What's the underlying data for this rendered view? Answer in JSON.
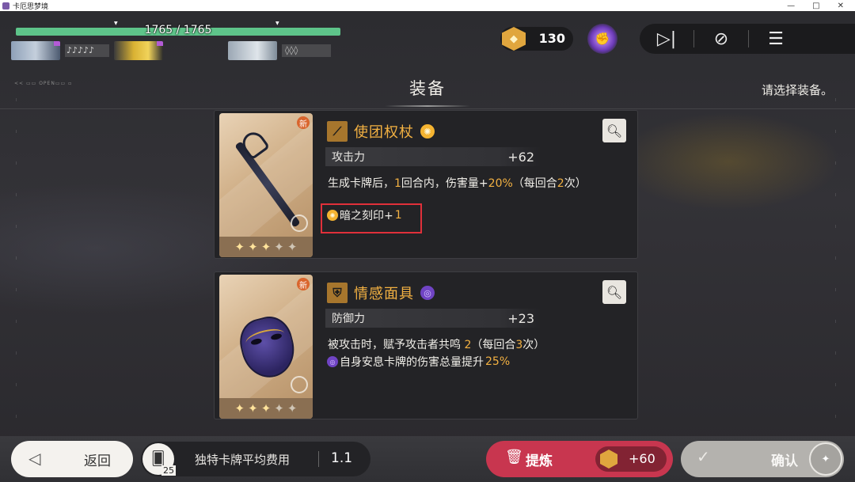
{
  "window": {
    "title": "卡厄思梦境",
    "minimize": "—",
    "maximize": "□",
    "close": "✕"
  },
  "hud": {
    "hp_text": "1765 / 1765",
    "hp_fraction": 1.0,
    "party": [
      {
        "name": "portrait-1",
        "extra": "♪♪♪♪♪"
      },
      {
        "name": "portrait-2",
        "extra": ""
      },
      {
        "name": "portrait-3",
        "extra": "◊◊◊"
      }
    ],
    "currency_value": "130",
    "currency_icon": "gem-icon",
    "controls": [
      "play-skip-icon",
      "speed-icon",
      "menu-icon"
    ]
  },
  "header": {
    "title": "装备",
    "hint": "请选择装备。",
    "mini_label": "<<  ▭▭  OPEN▭▭  ▫"
  },
  "equipment": [
    {
      "new_badge": "新",
      "type_icon": "sword-icon",
      "name": "使团权杖",
      "element_icon": "sun-icon",
      "stat_label": "攻击力",
      "stat_value": "+62",
      "desc_before": "生成卡牌后，",
      "desc_n1": "1",
      "desc_mid": "回合内，伤害量+",
      "desc_n2": "20%",
      "desc_after": "（每回合",
      "desc_n3": "2",
      "desc_end": "次）",
      "effect_text": "暗之刻印+",
      "effect_num": "1",
      "stars_on": 3,
      "stars_total": 5,
      "highlighted": true
    },
    {
      "new_badge": "新",
      "type_icon": "armor-icon",
      "name": "情感面具",
      "element_icon": "void-icon",
      "stat_label": "防御力",
      "stat_value": "+23",
      "desc_before": "被攻击时，赋予攻击者共鸣 ",
      "desc_n1": "2",
      "desc_mid": "（每回合",
      "desc_n2": "3",
      "desc_after": "次）",
      "effect_text": "自身安息卡牌的伤害总量提升",
      "effect_num": "25%",
      "stars_on": 3,
      "stars_total": 5,
      "highlighted": false
    }
  ],
  "bottom": {
    "back_label": "返回",
    "deck_label": "独特卡牌平均费用",
    "deck_count": "25",
    "deck_value": "1.1",
    "refine_label": "提炼",
    "refine_reward": "+60",
    "confirm_label": "确认"
  },
  "colors": {
    "accent": "#f3b142",
    "refine": "#c8364f",
    "hp": "#5ec48a",
    "highlight_box": "#e0303a"
  }
}
